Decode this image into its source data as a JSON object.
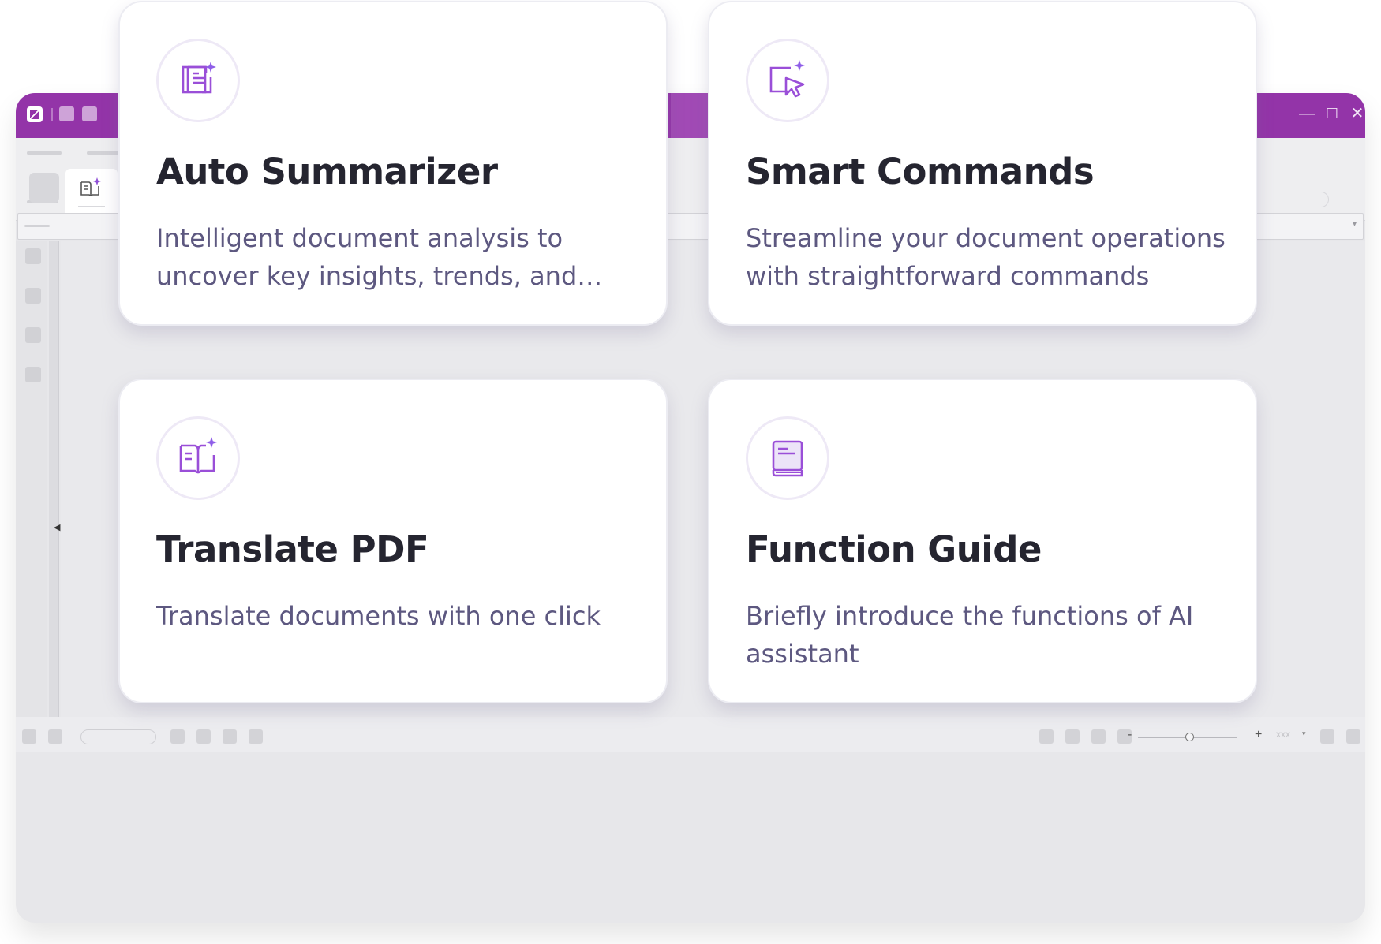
{
  "colors": {
    "brand": "#9334a8",
    "icon_accent": "#9a4fd8",
    "title_text": "#252530",
    "description_text": "#5d5880"
  },
  "app": {
    "window_controls": {
      "minimize": "—",
      "maximize": "☐",
      "close": "✕"
    },
    "statusbar": {
      "zoom_minus": "-",
      "zoom_plus": "+",
      "zoom_value": "xxx"
    }
  },
  "cards": [
    {
      "icon": "document-sparkle-icon",
      "title": "Auto Summarizer",
      "description": "Intelligent document analysis to uncover key insights, trends, and information"
    },
    {
      "icon": "cursor-sparkle-icon",
      "title": "Smart Commands",
      "description": "Streamline your document operations with straightforward commands"
    },
    {
      "icon": "book-sparkle-icon",
      "title": "Translate PDF",
      "description": "Translate documents with one click"
    },
    {
      "icon": "guide-book-icon",
      "title": "Function Guide",
      "description": "Briefly introduce the functions of AI assistant"
    }
  ]
}
